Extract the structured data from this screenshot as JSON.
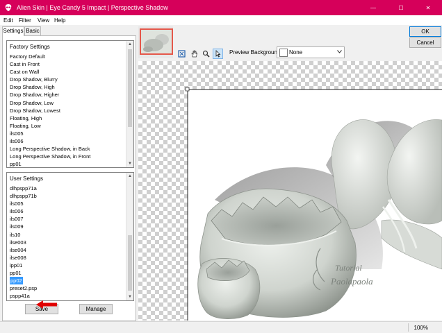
{
  "window": {
    "title": "Alien Skin | Eye Candy 5 Impact | Perspective Shadow",
    "minimize": "—",
    "maximize": "☐",
    "close": "✕"
  },
  "menu": [
    "Edit",
    "Filter",
    "View",
    "Help"
  ],
  "tabs": [
    "Settings",
    "Basic"
  ],
  "factory_settings": {
    "header": "Factory Settings",
    "items": [
      "Factory Default",
      "Cast in Front",
      "Cast on Wall",
      "Drop Shadow, Blurry",
      "Drop Shadow, High",
      "Drop Shadow, Higher",
      "Drop Shadow, Low",
      "Drop Shadow, Lowest",
      "Floating, High",
      "Floating, Low",
      "ils005",
      "ils006",
      "Long Perspective Shadow, in Back",
      "Long Perspective Shadow, in Front",
      "pp01"
    ]
  },
  "user_settings": {
    "header": "User Settings",
    "items": [
      "dlhpspp71a",
      "dlhpspp71b",
      "ils005",
      "ils006",
      "ils007",
      "ils009",
      "ils10",
      "ilse003",
      "ilse004",
      "ilse008",
      "ipp01",
      "pp01",
      "pp02",
      "preset2.psp",
      "pspp41a"
    ],
    "selected": "pp02"
  },
  "buttons": {
    "save": "Save",
    "manage": "Manage",
    "ok": "OK",
    "cancel": "Cancel"
  },
  "preview_background": {
    "label": "Preview Background:",
    "value": "None"
  },
  "tools": [
    "zoom-fit-icon",
    "hand-icon",
    "magnifier-icon",
    "arrow-pointer-icon"
  ],
  "watermark": {
    "line1": "Tutorial",
    "line2": "Paolapaola"
  },
  "status": {
    "zoom": "100%"
  },
  "colors": {
    "title_bar": "#d6005a",
    "selection": "#3399ff",
    "annotation_arrow": "#e00000"
  }
}
